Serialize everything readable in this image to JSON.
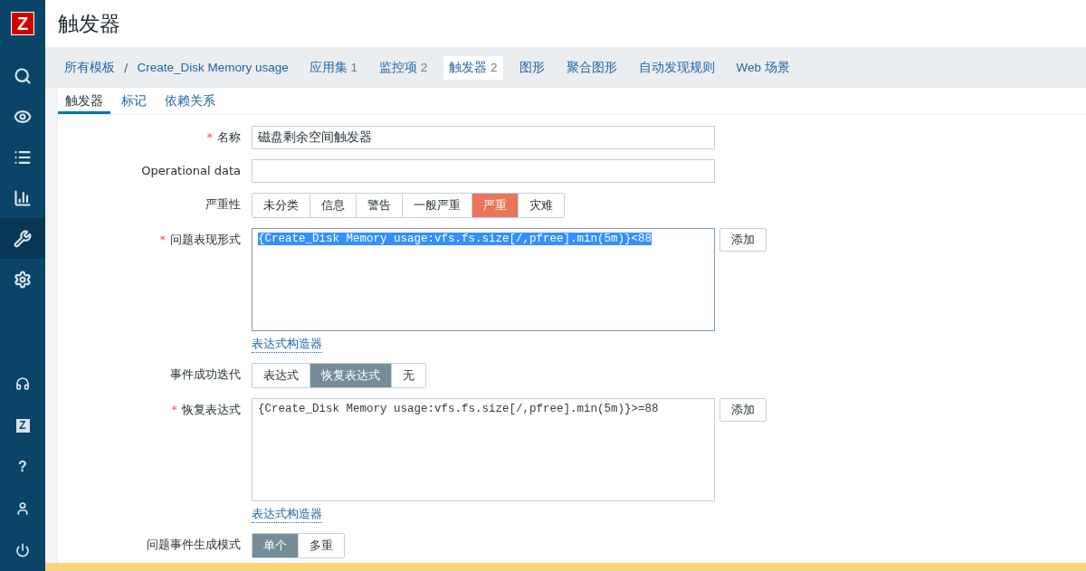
{
  "logo": {
    "text": "Z"
  },
  "sidebar": {
    "top_items": [
      {
        "selected": false
      },
      {
        "selected": false
      },
      {
        "selected": false
      },
      {
        "selected": false
      },
      {
        "selected": true
      },
      {
        "selected": false
      }
    ],
    "bottom_items": [
      {
        "selected": false
      },
      {
        "selected": false,
        "label": "Z"
      },
      {
        "selected": false,
        "label": "?"
      },
      {
        "selected": false
      },
      {
        "selected": false
      }
    ]
  },
  "page_title": "触发器",
  "breadcrumbs": [
    {
      "label": "所有模板"
    },
    {
      "separator": "/",
      "label": "Create_Disk Memory usage"
    }
  ],
  "nav_tabs": [
    {
      "label": "应用集",
      "count": "1",
      "selected": false
    },
    {
      "label": "监控项",
      "count": "2",
      "selected": false
    },
    {
      "label": "触发器",
      "count": "2",
      "selected": true
    },
    {
      "label": "图形",
      "selected": false
    },
    {
      "label": "聚合图形",
      "selected": false
    },
    {
      "label": "自动发现规则",
      "selected": false
    },
    {
      "label": "Web 场景",
      "selected": false
    }
  ],
  "sub_tabs": [
    {
      "label": "触发器",
      "selected": true
    },
    {
      "label": "标记",
      "selected": false
    },
    {
      "label": "依赖关系",
      "selected": false
    }
  ],
  "form": {
    "rows": [
      {
        "kind": "input",
        "label": "名称",
        "required_mark": "*",
        "value": "磁盘剩余空间触发器"
      },
      {
        "kind": "input",
        "label": "Operational data"
      },
      {
        "kind": "severity",
        "label": "严重性",
        "options": [
          {
            "label": "未分类",
            "selected": false
          },
          {
            "label": "信息",
            "selected": false
          },
          {
            "label": "警告",
            "selected": false
          },
          {
            "label": "一般严重",
            "selected": false
          },
          {
            "label": "严重",
            "selected": true
          },
          {
            "label": "灾难",
            "selected": false
          }
        ]
      },
      {
        "kind": "textarea",
        "label": "问题表现形式",
        "required_mark": "*",
        "value": "{Create_Disk Memory usage:vfs.fs.size[/,pfree].min(5m)}<88",
        "highlighted": true,
        "button": "添加",
        "link": "表达式构造器"
      },
      {
        "kind": "segmented",
        "label": "事件成功迭代",
        "options": [
          {
            "label": "表达式",
            "selected": false
          },
          {
            "label": "恢复表达式",
            "selected": true
          },
          {
            "label": "无",
            "selected": false
          }
        ]
      },
      {
        "kind": "textarea",
        "label": "恢复表达式",
        "required_mark": "*",
        "value": "{Create_Disk Memory usage:vfs.fs.size[/,pfree].min(5m)}>=88",
        "highlighted": false,
        "button": "添加",
        "link": "表达式构造器"
      },
      {
        "kind": "segmented",
        "label": "问题事件生成模式",
        "options": [
          {
            "label": "单个",
            "selected": true
          },
          {
            "label": "多重",
            "selected": false
          }
        ]
      }
    ]
  }
}
